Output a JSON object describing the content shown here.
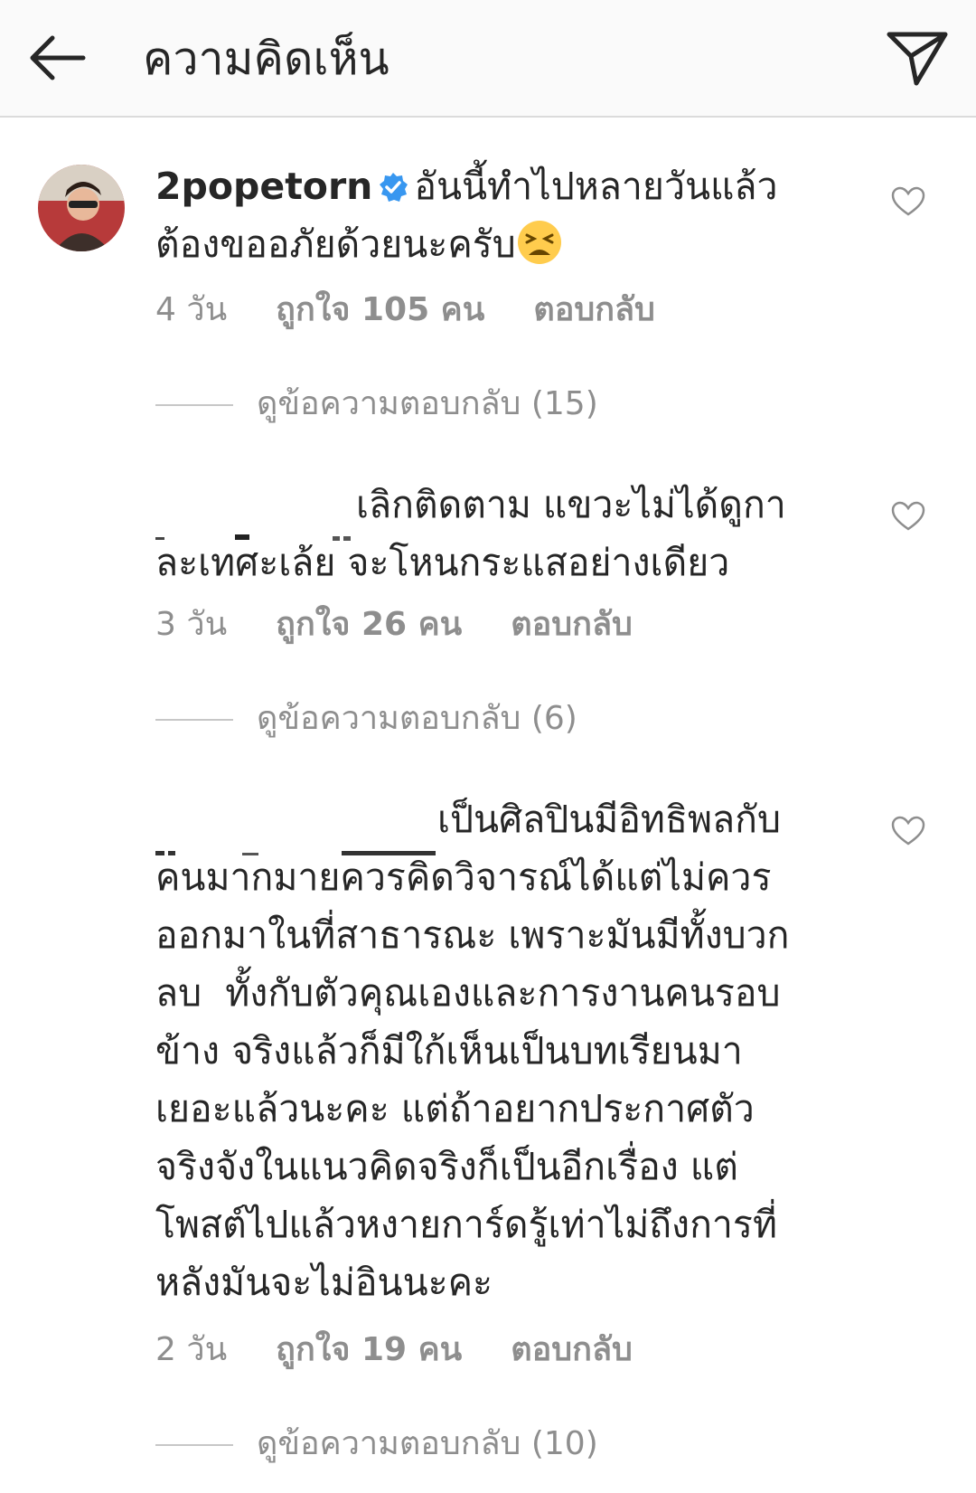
{
  "header": {
    "title": "ความคิดเห็น",
    "back_icon": "arrow-left-icon",
    "send_icon": "paper-plane-icon"
  },
  "comments": [
    {
      "username": "2popetorn",
      "verified": true,
      "text_lines": [
        "อันนี้ทำไปหลายวันแล้ว",
        "ต้องขออภัยด้วยนะครับ"
      ],
      "emoji": "tired-face-emoji",
      "time": "4 วัน",
      "likes": "ถูกใจ 105 คน",
      "reply": "ตอบกลับ",
      "view_replies": "ดูข้อความตอบกลับ (15)"
    },
    {
      "username": "",
      "text_lines": [
        "เลิกติดตาม แขวะไม่ได้ดูกา",
        "ละเทศะเล้ย จะโหนกระแสอย่างเดียว"
      ],
      "time": "3 วัน",
      "likes": "ถูกใจ 26 คน",
      "reply": "ตอบกลับ",
      "view_replies": "ดูข้อความตอบกลับ (6)"
    },
    {
      "username": "",
      "text_lines": [
        "เป็นศิลปินมีอิทธิพลกับ",
        "คนมากมายควรคิดวิจารณ์ได้แต่ไม่ควร",
        "ออกมาในที่สาธารณะ เพราะมันมีทั้งบวก",
        "ลบ  ทั้งกับตัวคุณเองและการงานคนรอบ",
        "ข้าง จริงแล้วก็มีใก้เห็นเป็นบทเรียนมา",
        "เยอะแล้วนะคะ แต่ถ้าอยากประกาศตัว",
        "จริงจังในแนวคิดจริงก็เป็นอีกเรื่อง แต่",
        "โพสต์ไปแล้วหงายการ์ดรู้เท่าไม่ถึงการที่",
        "หลังมันจะไม่อินนะคะ"
      ],
      "time": "2 วัน",
      "likes": "ถูกใจ 19 คน",
      "reply": "ตอบกลับ",
      "view_replies": "ดูข้อความตอบกลับ (10)"
    }
  ],
  "colors": {
    "text": "#262626",
    "secondary": "#8e8e8e",
    "verified": "#3897f0",
    "header_bg": "#fafafa"
  }
}
